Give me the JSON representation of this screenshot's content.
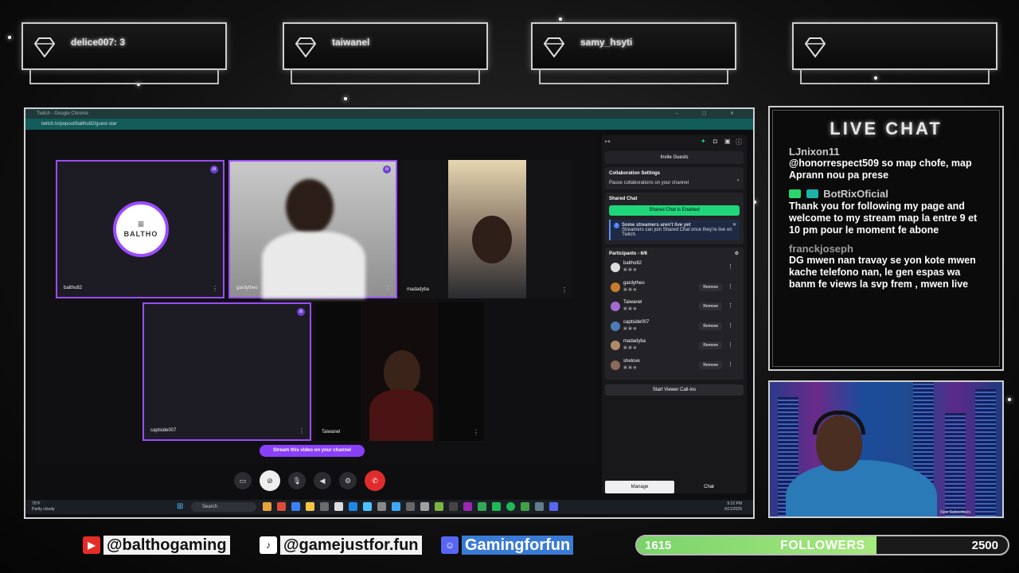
{
  "badges": [
    {
      "name": "delice007: 3"
    },
    {
      "name": "taiwanel"
    },
    {
      "name": "samy_hsyti"
    },
    {
      "name": ""
    }
  ],
  "browser": {
    "title": "Twitch - Google Chrome",
    "url": "twitch.tv/popout/baltho82/guest-star"
  },
  "tiles": [
    {
      "name": "baltho82",
      "logo_text": "BALTHO"
    },
    {
      "name": "gardytheo"
    },
    {
      "name": "madadyba"
    },
    {
      "name": "captside007"
    },
    {
      "name": "Taiwanel"
    }
  ],
  "stage": {
    "stream_button": "Stream this video on your channel"
  },
  "panel": {
    "invite_guests": "Invite Guests",
    "collab_title": "Collaboration Settings",
    "collab_pause": "Pause collaborations on your channel",
    "shared_chat_title": "Shared Chat",
    "shared_chat_enabled": "Shared Chat is Enabled",
    "info_title": "Some streamers aren't live yet",
    "info_body": "Streamers can join Shared Chat once they're live on Twitch.",
    "participants_title": "Participants - 6/6",
    "participants": [
      {
        "name": "baltho82",
        "removable": false,
        "color": "#dddddd"
      },
      {
        "name": "gardytheo",
        "removable": true,
        "color": "#c77d2e"
      },
      {
        "name": "Taiwanel",
        "removable": true,
        "color": "#a36bd0"
      },
      {
        "name": "captside007",
        "removable": true,
        "color": "#4d7bb3"
      },
      {
        "name": "madadyba",
        "removable": true,
        "color": "#b08a6a"
      },
      {
        "name": "shelove",
        "removable": true,
        "color": "#8a6a5a"
      }
    ],
    "remove_label": "Remove",
    "viewer_callins": "Start Viewer Call-ins",
    "tab_manage": "Manage",
    "tab_chat": "Chat"
  },
  "taskbar": {
    "temp": "70°F",
    "weather": "Partly cloudy",
    "search": "Search",
    "time": "9:22 PM",
    "date": "6/11/2025"
  },
  "live_chat": {
    "title": "LIVE CHAT",
    "messages": [
      {
        "user": "LJnixon11",
        "text": "@honorrespect509 so map chofe, map Aprann nou pa prese"
      },
      {
        "user": "BotRixOficial",
        "text": "Thank you for following my page and welcome to my stream map la entre 9 et 10 pm pour le moment fe abone"
      },
      {
        "user": "franckjoseph",
        "text": "DG mwen nan travay se yon kote mwen kache telefono nan, le gen espas wa banm fe views la svp frem , mwen live"
      }
    ]
  },
  "webcam": {
    "overlay_text": "New Subscribers"
  },
  "footer": {
    "youtube": "@balthogaming",
    "tiktok": "@gamejustfor.fun",
    "discord": "Gamingforfun",
    "followers_current": "1615",
    "followers_label": "FOLLOWERS",
    "followers_goal": "2500",
    "followers_progress": 0.646
  },
  "colors": {
    "accent_purple": "#9b4dff",
    "shared_green": "#1fd67a",
    "end_call_red": "#e02c2c",
    "progress_green": "#8bdc72"
  }
}
